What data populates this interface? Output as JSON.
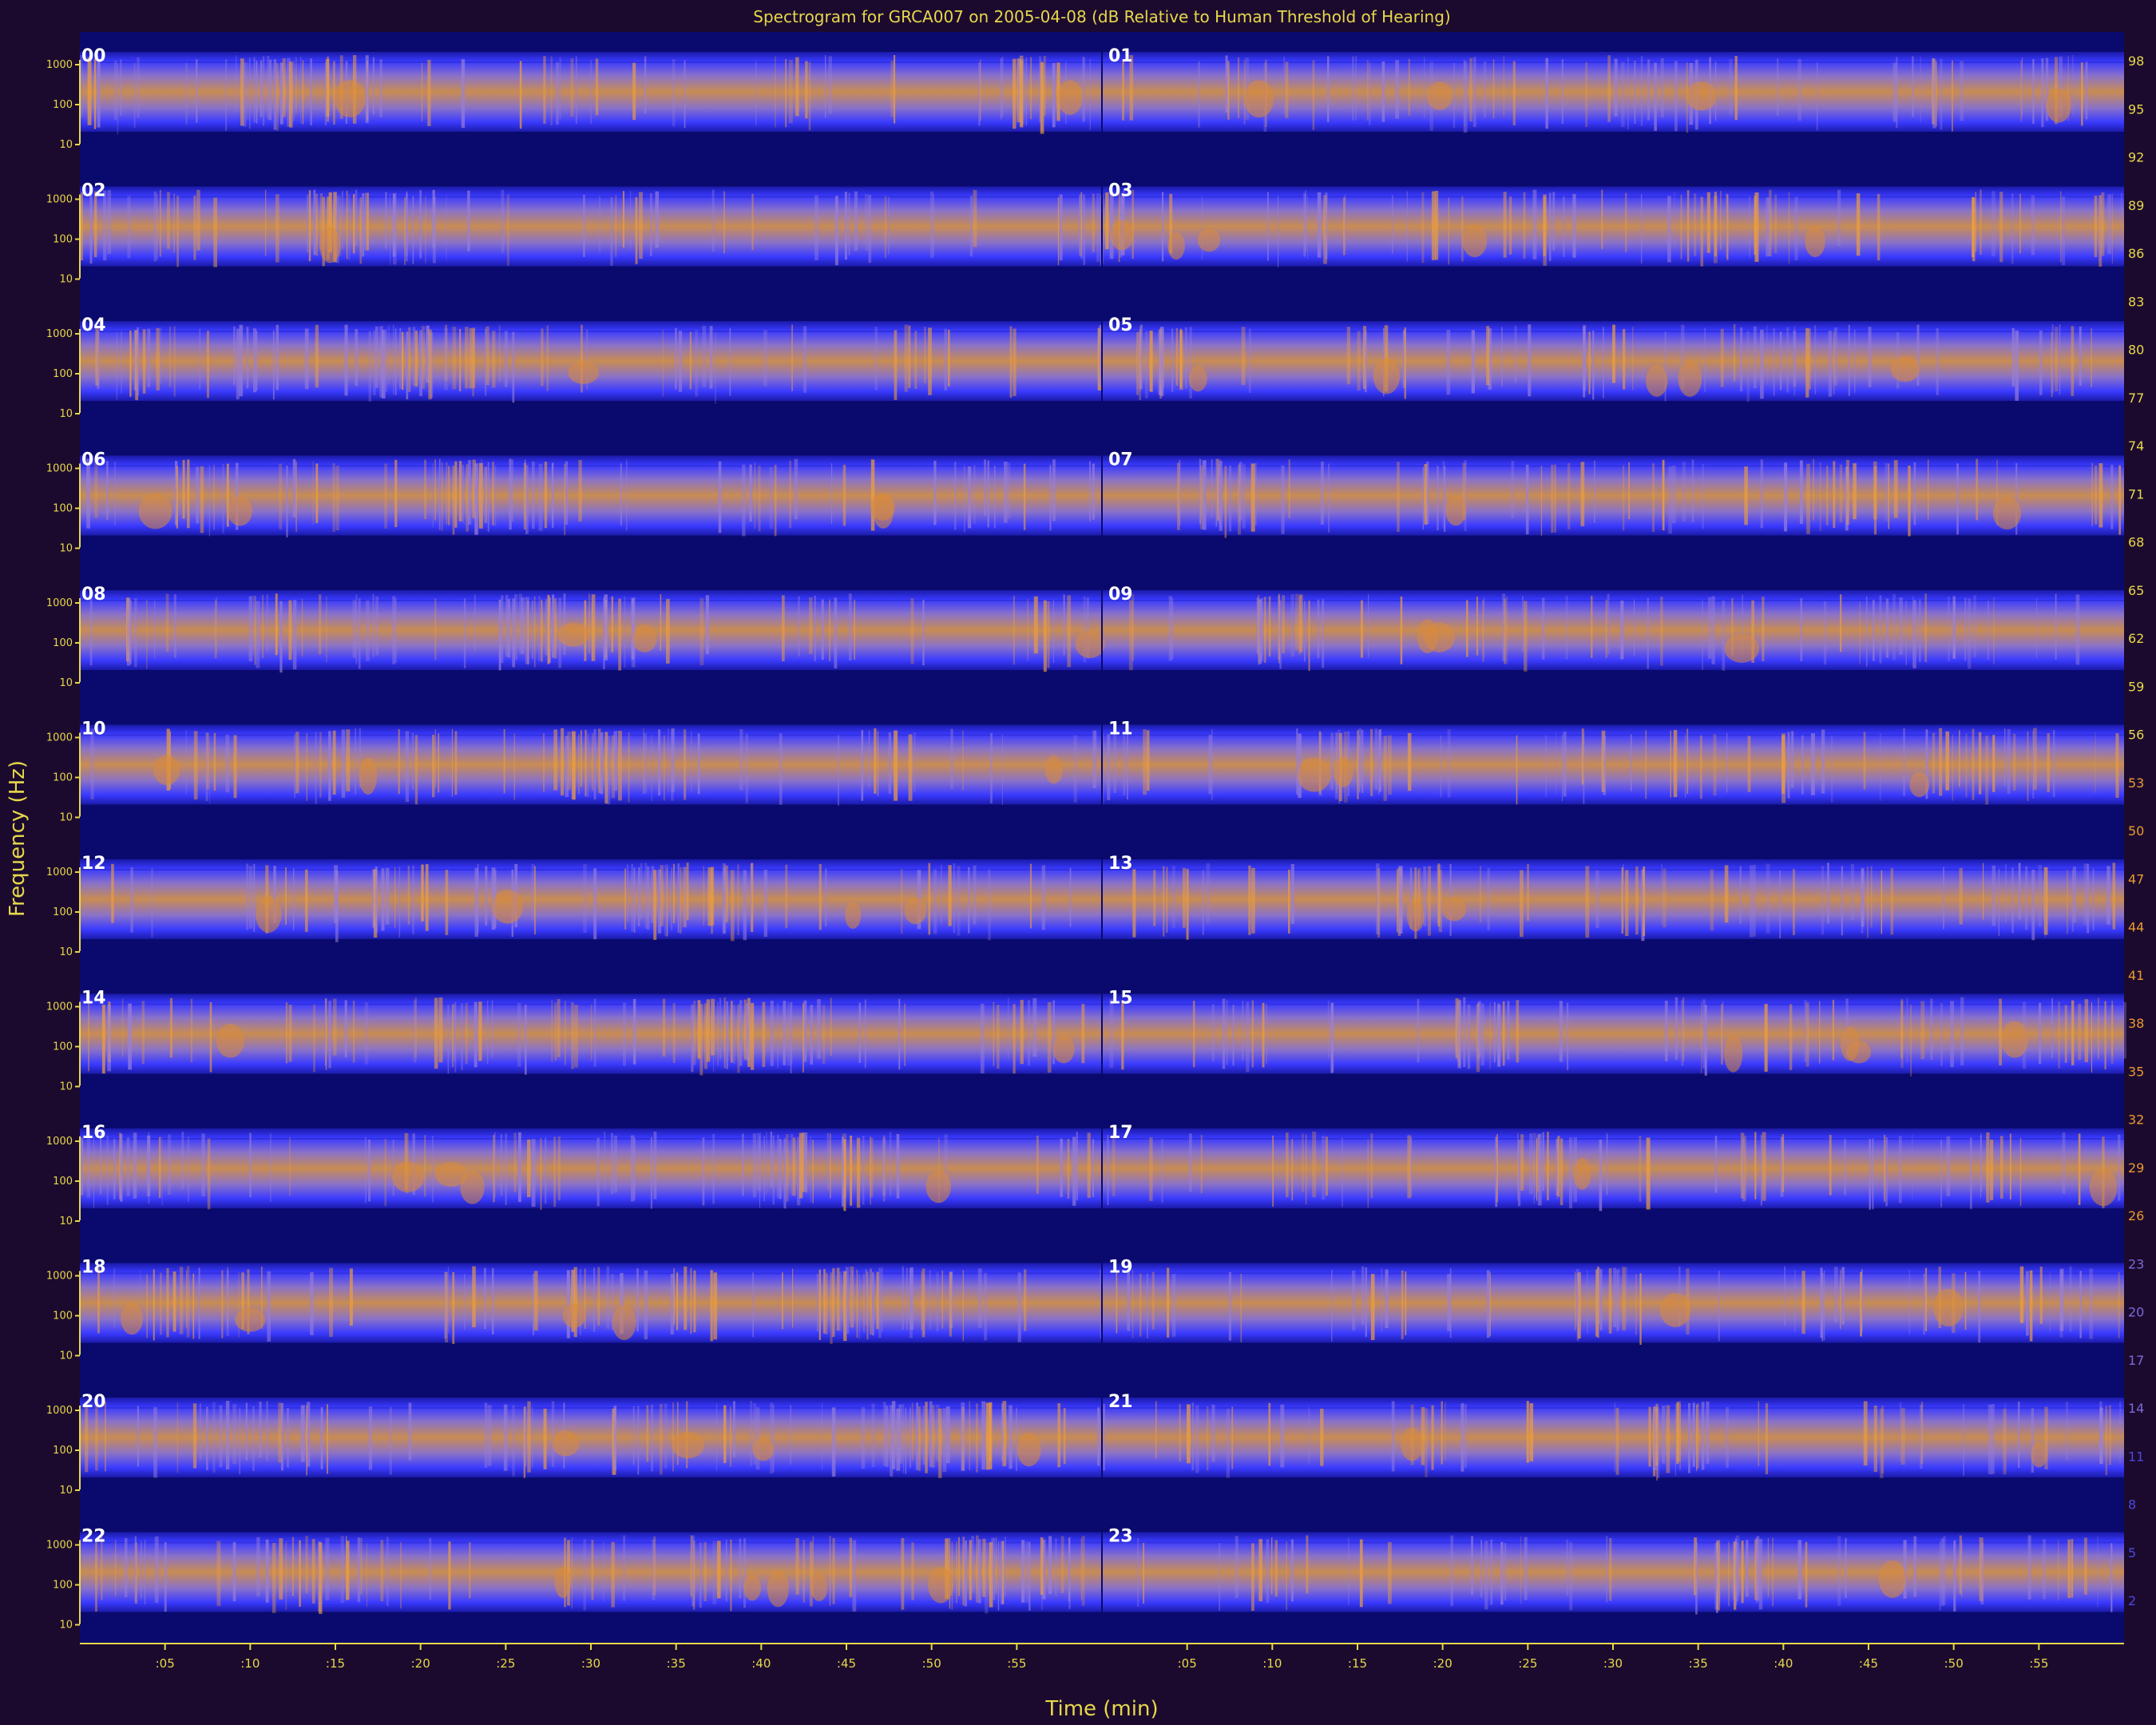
{
  "chart_data": {
    "type": "heatmap",
    "title": "Spectrogram for GRCA007 on 2005-04-08 (dB Relative to Human Threshold of Hearing)",
    "xlabel": "Time (min)",
    "ylabel": "Frequency (Hz)",
    "panel_time_ticks": [
      ":05",
      ":10",
      ":15",
      ":20",
      ":25",
      ":30",
      ":35",
      ":40",
      ":45",
      ":50",
      ":55"
    ],
    "frequency_ticks": [
      "1000",
      "100",
      "10"
    ],
    "hour_labels": [
      "00",
      "01",
      "02",
      "03",
      "04",
      "05",
      "06",
      "07",
      "08",
      "09",
      "10",
      "11",
      "12",
      "13",
      "14",
      "15",
      "16",
      "17",
      "18",
      "19",
      "20",
      "21",
      "22",
      "23"
    ],
    "colorbar_ticks": [
      98,
      95,
      92,
      89,
      86,
      83,
      80,
      77,
      74,
      71,
      68,
      65,
      62,
      59,
      56,
      53,
      50,
      47,
      44,
      41,
      38,
      35,
      32,
      29,
      26,
      23,
      20,
      17,
      14,
      11,
      8,
      5,
      2
    ],
    "colormap": [
      "#0a0a6e",
      "#2424ff",
      "#7a6ad6",
      "#e89a2e"
    ],
    "grid": false
  }
}
